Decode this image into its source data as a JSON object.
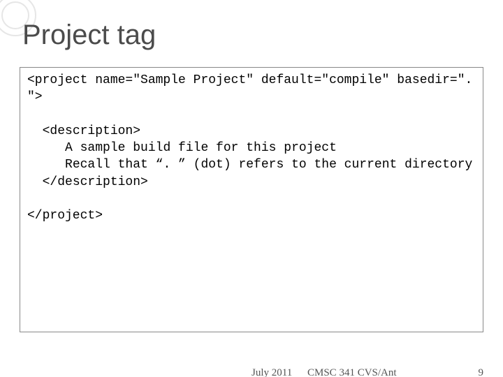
{
  "title": "Project tag",
  "code": {
    "line1": "<project name=\"Sample Project\" default=\"compile\" basedir=\". \">",
    "blank1": "",
    "line2": "  <description>",
    "line3": "     A sample build file for this project",
    "line4": "     Recall that “. ” (dot) refers to the current directory",
    "line5": "  </description>",
    "blank2": "",
    "line6": "</project>"
  },
  "footer": {
    "date": "July 2011",
    "course": "CMSC 341 CVS/Ant",
    "page": "9"
  }
}
